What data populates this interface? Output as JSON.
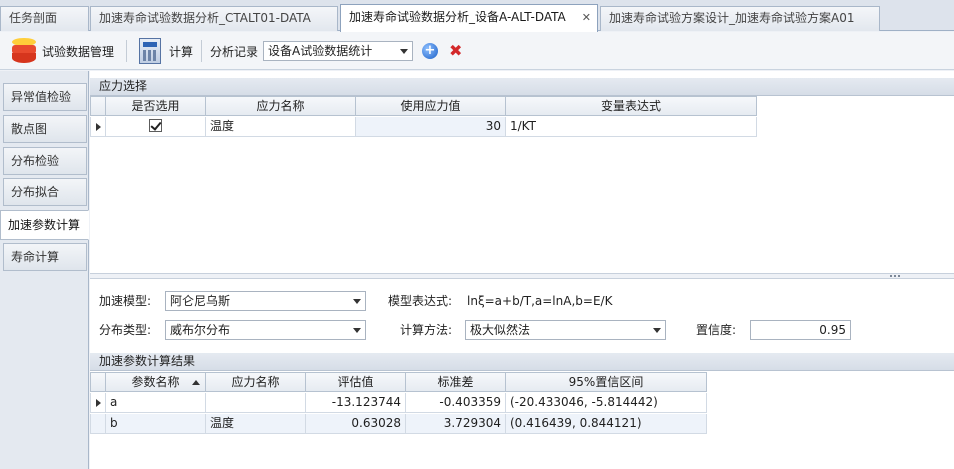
{
  "tabs": [
    {
      "label": "任务剖面"
    },
    {
      "label": "加速寿命试验数据分析_CTALT01-DATA"
    },
    {
      "label": "加速寿命试验数据分析_设备A-ALT-DATA"
    },
    {
      "label": "加速寿命试验方案设计_加速寿命试验方案A01"
    }
  ],
  "toolbar": {
    "data_mgmt_label": "试验数据管理",
    "compute_label": "计算",
    "analysis_record_label": "分析记录",
    "analysis_record_value": "设备A试验数据统计"
  },
  "sidenav": {
    "items": [
      {
        "label": "异常值检验"
      },
      {
        "label": "散点图"
      },
      {
        "label": "分布检验"
      },
      {
        "label": "分布拟合"
      },
      {
        "label": "加速参数计算"
      },
      {
        "label": "寿命计算"
      }
    ]
  },
  "stress_section": {
    "title": "应力选择",
    "columns": [
      "是否选用",
      "应力名称",
      "使用应力值",
      "变量表达式"
    ],
    "rows": [
      {
        "selected": true,
        "name": "温度",
        "value": "30",
        "expression": "1/KT"
      }
    ]
  },
  "settings": {
    "accel_model_label": "加速模型:",
    "accel_model_value": "阿仑尼乌斯",
    "model_expr_label": "模型表达式:",
    "model_expr_value": "lnξ=a+b/T,a=lnA,b=E/K",
    "distribution_label": "分布类型:",
    "distribution_value": "威布尔分布",
    "method_label": "计算方法:",
    "method_value": "极大似然法",
    "confidence_label": "置信度:",
    "confidence_value": "0.95"
  },
  "results_section": {
    "title": "加速参数计算结果",
    "columns": [
      "参数名称",
      "应力名称",
      "评估值",
      "标准差",
      "95%置信区间"
    ],
    "rows": [
      {
        "param": "a",
        "stress": "",
        "estimate": "-13.123744",
        "stddev": "-0.403359",
        "ci": "(-20.433046, -5.814442)"
      },
      {
        "param": "b",
        "stress": "温度",
        "estimate": "0.63028",
        "stddev": "3.729304",
        "ci": "(0.416439, 0.844121)"
      }
    ]
  },
  "colors": {
    "accent": "#1a5fc7",
    "delete": "#d3282a",
    "tab_bg": "#dde3ec"
  }
}
